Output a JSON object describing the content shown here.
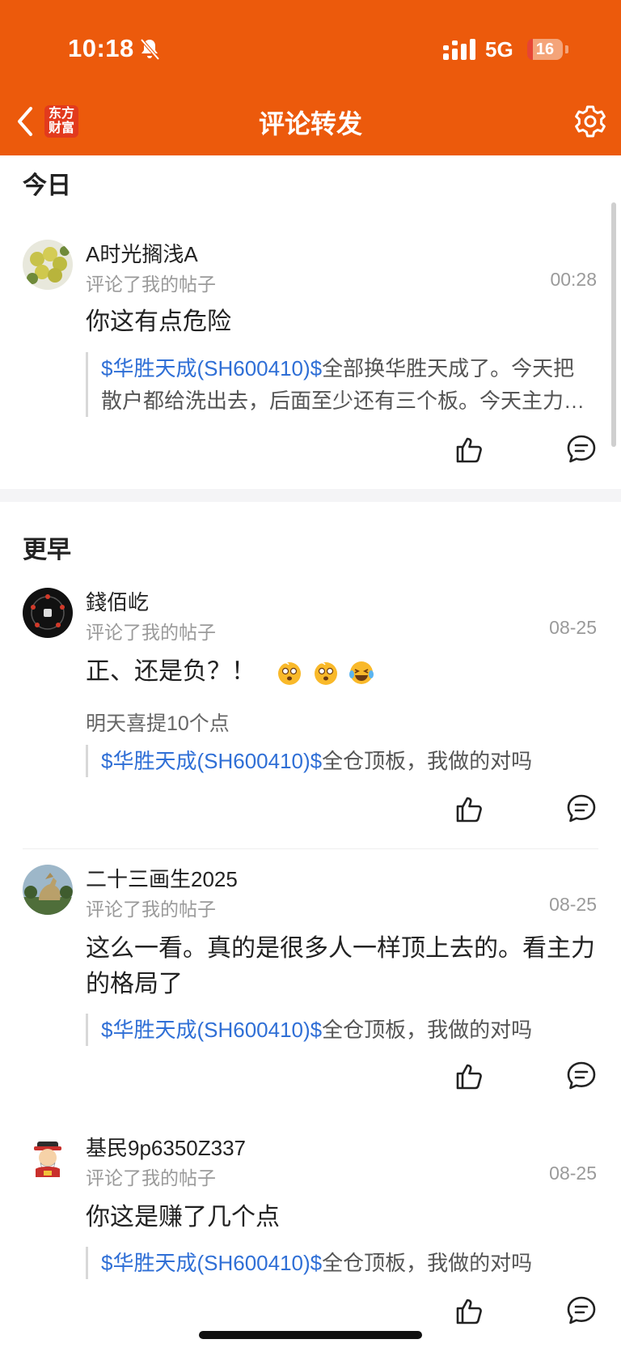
{
  "status_bar": {
    "time": "10:18",
    "network": "5G",
    "battery": "16",
    "battery_level": 0.16
  },
  "header": {
    "logo_text": "东方财富",
    "logo_line1": "东方",
    "logo_line2": "财富",
    "title": "评论转发"
  },
  "colors": {
    "header_bg": "#ec5a0c",
    "link": "#2f6fd6"
  },
  "sections": [
    {
      "heading": "今日"
    },
    {
      "heading": "更早"
    }
  ],
  "items": [
    {
      "user": "A时光搁浅A",
      "action": "评论了我的帖子",
      "time": "00:28",
      "comment": "你这有点危险",
      "quote_link": "$华胜天成(SH600410)$",
      "quote_text": "全部换华胜天成了。今天把散户都给洗出去，后面至少还有三个板。今天主力…",
      "avatar_icon": "oranges-avatar-icon"
    },
    {
      "user": "錢佰屹",
      "action": "评论了我的帖子",
      "time": "08-25",
      "comment": "正、还是负？！",
      "sub_text": "明天喜提10个点",
      "emojis": [
        "dizzy-face-icon",
        "dizzy-face-icon",
        "laughing-tears-icon"
      ],
      "quote_link": "$华胜天成(SH600410)$",
      "quote_text": "全仓顶板，我做的对吗",
      "avatar_icon": "dark-pattern-avatar-icon"
    },
    {
      "user": "二十三画生2025",
      "action": "评论了我的帖子",
      "time": "08-25",
      "comment": "这么一看。真的是很多人一样顶上去的。看主力的格局了",
      "quote_link": "$华胜天成(SH600410)$",
      "quote_text": "全仓顶板，我做的对吗",
      "avatar_icon": "rooster-statue-avatar-icon"
    },
    {
      "user": "基民9p6350Z337",
      "action": "评论了我的帖子",
      "time": "08-25",
      "comment": "你这是赚了几个点",
      "quote_link": "$华胜天成(SH600410)$",
      "quote_text": "全仓顶板，我做的对吗",
      "avatar_icon": "fortune-god-avatar-icon"
    }
  ],
  "icons": [
    "back-icon",
    "settings-gear-icon",
    "thumbs-up-icon",
    "comment-icon",
    "mute-bell-icon",
    "signal-icon"
  ]
}
